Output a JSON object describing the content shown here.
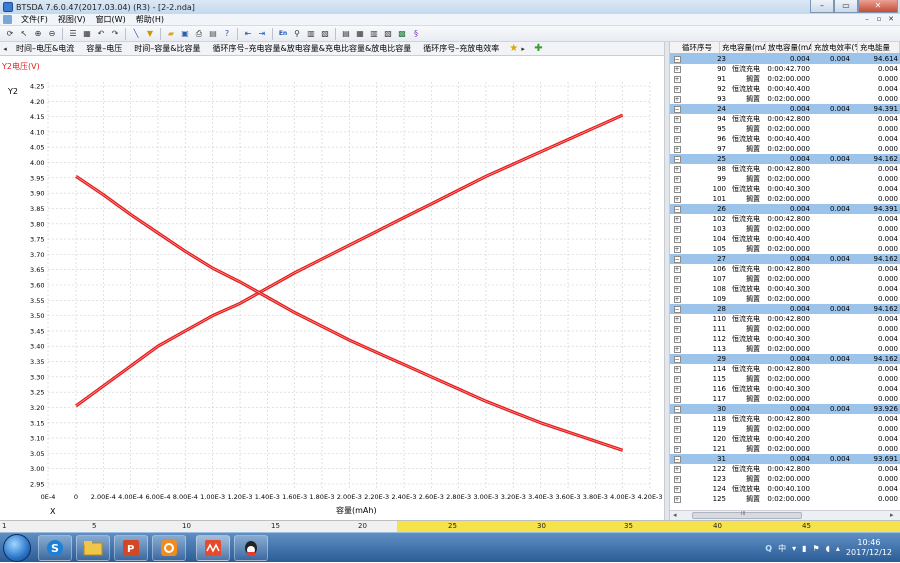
{
  "window": {
    "title": "BTSDA 7.6.0.47(2017.03.04) (R3) - [2-2.nda]",
    "min": "–",
    "max": "▭",
    "close": "✕"
  },
  "menu": {
    "items": [
      "文件(F)",
      "视图(V)",
      "窗口(W)",
      "帮助(H)"
    ]
  },
  "tabs": [
    "时间–电压&电流",
    "容量–电压",
    "时间–容量&比容量",
    "循环序号–充电容量&放电容量&充电比容量&放电比容量",
    "循环序号–充放电效率"
  ],
  "chart_data": {
    "type": "line",
    "y_axis_title": "Y2电压(V)",
    "y_axis_name": "Y2",
    "x_axis_title": "容量(mAh)",
    "x_axis_name": "X",
    "xlim": [
      0,
      0.0042
    ],
    "ylim": [
      2.95,
      4.25
    ],
    "grid": true,
    "x_ticks": [
      "0E-4",
      "0",
      "2.00E-4",
      "4.00E-4",
      "6.00E-4",
      "8.00E-4",
      "1.00E-3",
      "1.20E-3",
      "1.40E-3",
      "1.60E-3",
      "1.80E-3",
      "2.00E-3",
      "2.20E-3",
      "2.40E-3",
      "2.60E-3",
      "2.80E-3",
      "3.00E-3",
      "3.20E-3",
      "3.40E-3",
      "3.60E-3",
      "3.80E-3",
      "4.00E-3",
      "4.20E-3"
    ],
    "y_ticks": [
      "4.25",
      "4.20",
      "4.15",
      "4.10",
      "4.05",
      "4.00",
      "3.95",
      "3.90",
      "3.85",
      "3.80",
      "3.75",
      "3.70",
      "3.65",
      "3.60",
      "3.55",
      "3.50",
      "3.45",
      "3.40",
      "3.35",
      "3.30",
      "3.25",
      "3.20",
      "3.15",
      "3.10",
      "3.05",
      "3.00",
      "2.95"
    ],
    "color": "#e51d1d",
    "series": [
      {
        "x": [
          0,
          0.0002,
          0.0004,
          0.0006,
          0.0008,
          0.001,
          0.0012,
          0.0014,
          0.0016,
          0.0018,
          0.002,
          0.0022,
          0.0024,
          0.0026,
          0.0028,
          0.003,
          0.0032,
          0.0034,
          0.0036,
          0.0038,
          0.004
        ],
        "y": [
          3.205,
          3.27,
          3.335,
          3.4,
          3.45,
          3.5,
          3.54,
          3.59,
          3.64,
          3.685,
          3.73,
          3.775,
          3.82,
          3.865,
          3.91,
          3.955,
          3.995,
          4.035,
          4.075,
          4.115,
          4.155
        ]
      },
      {
        "x": [
          0,
          0.0002,
          0.0004,
          0.0006,
          0.0008,
          0.001,
          0.0012,
          0.0014,
          0.0016,
          0.0018,
          0.002,
          0.0022,
          0.0024,
          0.0026,
          0.0028,
          0.003,
          0.0032,
          0.0034,
          0.0036,
          0.0038,
          0.004
        ],
        "y": [
          3.955,
          3.895,
          3.83,
          3.77,
          3.71,
          3.655,
          3.61,
          3.56,
          3.51,
          3.465,
          3.42,
          3.38,
          3.34,
          3.3,
          3.26,
          3.22,
          3.185,
          3.15,
          3.12,
          3.09,
          3.06
        ]
      }
    ]
  },
  "table": {
    "headers": [
      "循环序号",
      "充电容量(mAh)",
      "放电容量(mAh)",
      "充放电效率(%)",
      "充电能量"
    ],
    "cycles": [
      {
        "id": "23",
        "charge": "0.004",
        "discharge": "0.004",
        "eff": "94.614",
        "steps": [
          [
            "90",
            "恒流充电",
            "0:00:42.700",
            "0.004"
          ],
          [
            "91",
            "搁置",
            "0:02:00.000",
            "0.000"
          ],
          [
            "92",
            "恒流放电",
            "0:00:40.400",
            "0.004"
          ],
          [
            "93",
            "搁置",
            "0:02:00.000",
            "0.000"
          ]
        ]
      },
      {
        "id": "24",
        "charge": "0.004",
        "discharge": "0.004",
        "eff": "94.391",
        "steps": [
          [
            "94",
            "恒流充电",
            "0:00:42.800",
            "0.004"
          ],
          [
            "95",
            "搁置",
            "0:02:00.000",
            "0.000"
          ],
          [
            "96",
            "恒流放电",
            "0:00:40.400",
            "0.004"
          ],
          [
            "97",
            "搁置",
            "0:02:00.000",
            "0.000"
          ]
        ]
      },
      {
        "id": "25",
        "charge": "0.004",
        "discharge": "0.004",
        "eff": "94.162",
        "steps": [
          [
            "98",
            "恒流充电",
            "0:00:42.800",
            "0.004"
          ],
          [
            "99",
            "搁置",
            "0:02:00.000",
            "0.000"
          ],
          [
            "100",
            "恒流放电",
            "0:00:40.300",
            "0.004"
          ],
          [
            "101",
            "搁置",
            "0:02:00.000",
            "0.000"
          ]
        ]
      },
      {
        "id": "26",
        "charge": "0.004",
        "discharge": "0.004",
        "eff": "94.391",
        "steps": [
          [
            "102",
            "恒流充电",
            "0:00:42.800",
            "0.004"
          ],
          [
            "103",
            "搁置",
            "0:02:00.000",
            "0.000"
          ],
          [
            "104",
            "恒流放电",
            "0:00:40.400",
            "0.004"
          ],
          [
            "105",
            "搁置",
            "0:02:00.000",
            "0.000"
          ]
        ]
      },
      {
        "id": "27",
        "charge": "0.004",
        "discharge": "0.004",
        "eff": "94.162",
        "steps": [
          [
            "106",
            "恒流充电",
            "0:00:42.800",
            "0.004"
          ],
          [
            "107",
            "搁置",
            "0:02:00.000",
            "0.000"
          ],
          [
            "108",
            "恒流放电",
            "0:00:40.300",
            "0.004"
          ],
          [
            "109",
            "搁置",
            "0:02:00.000",
            "0.000"
          ]
        ]
      },
      {
        "id": "28",
        "charge": "0.004",
        "discharge": "0.004",
        "eff": "94.162",
        "steps": [
          [
            "110",
            "恒流充电",
            "0:00:42.800",
            "0.004"
          ],
          [
            "111",
            "搁置",
            "0:02:00.000",
            "0.000"
          ],
          [
            "112",
            "恒流放电",
            "0:00:40.300",
            "0.004"
          ],
          [
            "113",
            "搁置",
            "0:02:00.000",
            "0.000"
          ]
        ]
      },
      {
        "id": "29",
        "charge": "0.004",
        "discharge": "0.004",
        "eff": "94.162",
        "steps": [
          [
            "114",
            "恒流充电",
            "0:00:42.800",
            "0.004"
          ],
          [
            "115",
            "搁置",
            "0:02:00.000",
            "0.000"
          ],
          [
            "116",
            "恒流放电",
            "0:00:40.300",
            "0.004"
          ],
          [
            "117",
            "搁置",
            "0:02:00.000",
            "0.000"
          ]
        ]
      },
      {
        "id": "30",
        "charge": "0.004",
        "discharge": "0.004",
        "eff": "93.926",
        "steps": [
          [
            "118",
            "恒流充电",
            "0:00:42.800",
            "0.004"
          ],
          [
            "119",
            "搁置",
            "0:02:00.000",
            "0.000"
          ],
          [
            "120",
            "恒流放电",
            "0:00:40.200",
            "0.004"
          ],
          [
            "121",
            "搁置",
            "0:02:00.000",
            "0.000"
          ]
        ]
      },
      {
        "id": "31",
        "charge": "0.004",
        "discharge": "0.004",
        "eff": "93.691",
        "steps": [
          [
            "122",
            "恒流充电",
            "0:00:42.800",
            "0.004"
          ],
          [
            "123",
            "搁置",
            "0:02:00.000",
            "0.000"
          ],
          [
            "124",
            "恒流放电",
            "0:00:40.100",
            "0.004"
          ],
          [
            "125",
            "搁置",
            "0:02:00.000",
            "0.000"
          ]
        ]
      }
    ],
    "scroll_grip": "III"
  },
  "ruler": {
    "labels": [
      "1",
      "5",
      "10",
      "15",
      "20",
      "25",
      "30",
      "35",
      "40",
      "45"
    ]
  },
  "taskbar": {
    "time": "10:46",
    "date": "2017/12/12",
    "lang": "中",
    "lang_icon": "Q"
  }
}
